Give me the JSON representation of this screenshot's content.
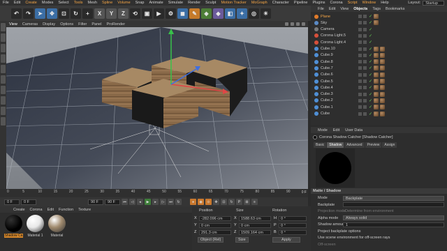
{
  "menu": [
    "File",
    "Edit",
    "Create",
    "Modes",
    "Select",
    "Tools",
    "Mesh",
    "Spline",
    "Volume",
    "Snap",
    "Animate",
    "Simulate",
    "Render",
    "Sculpt",
    "Motion Tracker",
    "MoGraph",
    "Character",
    "Pipeline",
    "Plugins",
    "Corona",
    "Script",
    "Window",
    "Help"
  ],
  "highlighted_menu": [
    "Create",
    "Tools",
    "Spline",
    "Volume",
    "Motion Tracker",
    "MoGraph",
    "Script",
    "Window"
  ],
  "layout": {
    "label": "Layout:",
    "value": "Startup"
  },
  "toolbar": [
    "X",
    "Y",
    "Z"
  ],
  "viewport_menu": {
    "items": [
      "View",
      "Cameras",
      "Display",
      "Options",
      "Filter",
      "Panel",
      "ProRender"
    ],
    "selected": "View"
  },
  "timeline": {
    "ticks": [
      "0",
      "5",
      "10",
      "15",
      "20",
      "25",
      "30",
      "35",
      "40",
      "45",
      "50",
      "55",
      "60",
      "65",
      "70",
      "75",
      "80",
      "85",
      "90"
    ],
    "end_label": "0 F",
    "start_field": "0 F",
    "current_field": "0 F",
    "end_field": "90 F",
    "end_field2": "90 F"
  },
  "material_manager": {
    "menu": [
      "Create",
      "Corona",
      "Edit",
      "Function",
      "Texture"
    ],
    "materials": [
      {
        "label": "Shadow Ca",
        "selected": true,
        "color": "#000000"
      },
      {
        "label": "Material 1",
        "selected": false,
        "color": "#e8e8e8"
      },
      {
        "label": "Material",
        "selected": false,
        "color": "#a08a6e"
      }
    ]
  },
  "coordinates": {
    "headers": [
      "Position",
      "Size",
      "Rotation"
    ],
    "rows": [
      {
        "axis": "X",
        "pos": "-282.096 cm",
        "size_axis": "X",
        "size": "1588.63 cm",
        "rot_axis": "H",
        "rot": "0 °"
      },
      {
        "axis": "Y",
        "pos": "0 cm",
        "size_axis": "Y",
        "size": "0 cm",
        "rot_axis": "P",
        "rot": "0 °"
      },
      {
        "axis": "Z",
        "pos": "291.3 cm",
        "size_axis": "Z",
        "size": "1509.164 cm",
        "rot_axis": "B",
        "rot": "0 °"
      }
    ],
    "mode": "Object (Rel)",
    "size_mode": "Size",
    "apply": "Apply"
  },
  "object_manager": {
    "tabs": [
      "File",
      "Edit",
      "View",
      "Objects",
      "Tags",
      "Bookmarks"
    ],
    "active_tab": "Objects",
    "objects": [
      {
        "name": "Plane",
        "color": "#e07b2a",
        "tags": 1,
        "sel": true
      },
      {
        "name": "Sky",
        "color": "#5a8ac6",
        "tags": 1
      },
      {
        "name": "Camera",
        "color": "#7a7a7a",
        "tags": 0
      },
      {
        "name": "Corona Light.5",
        "color": "#d84f3a",
        "tags": 0
      },
      {
        "name": "Corona Light.4",
        "color": "#d84f3a",
        "tags": 0
      },
      {
        "name": "Cube.10",
        "color": "#4f8fd6",
        "tags": 2
      },
      {
        "name": "Cube.9",
        "color": "#4f8fd6",
        "tags": 2
      },
      {
        "name": "Cube.8",
        "color": "#4f8fd6",
        "tags": 2
      },
      {
        "name": "Cube.7",
        "color": "#4f8fd6",
        "tags": 2
      },
      {
        "name": "Cube.6",
        "color": "#4f8fd6",
        "tags": 2
      },
      {
        "name": "Cube.5",
        "color": "#4f8fd6",
        "tags": 2
      },
      {
        "name": "Cube.4",
        "color": "#4f8fd6",
        "tags": 2
      },
      {
        "name": "Cube.3",
        "color": "#4f8fd6",
        "tags": 2
      },
      {
        "name": "Cube.2",
        "color": "#4f8fd6",
        "tags": 2
      },
      {
        "name": "Cube.1",
        "color": "#4f8fd6",
        "tags": 2
      },
      {
        "name": "Cube",
        "color": "#4f8fd6",
        "tags": 2
      }
    ]
  },
  "attributes": {
    "menu": [
      "Mode",
      "Edit",
      "User Data"
    ],
    "title": "Corona Shadow Catcher [Shadow Catcher]",
    "tabs": [
      "Basic",
      "Shadow",
      "Advanced",
      "Preview",
      "Assign"
    ],
    "active_tab": "Shadow",
    "section": "Matte / Shadow",
    "rows": [
      {
        "label": "Mode",
        "value": "Backplate",
        "kind": "dd"
      },
      {
        "label": "Backplate",
        "value": "",
        "kind": "fld"
      },
      {
        "label": "Projection mode",
        "value": "Determine from environment",
        "kind": "dim"
      },
      {
        "label": "Alpha mode",
        "value": "Always solid",
        "kind": "dd"
      },
      {
        "label": "Shadow amount",
        "value": "1",
        "kind": "fld"
      },
      {
        "label": "Project backplate options",
        "value": "",
        "kind": "none"
      },
      {
        "label": "Use scene environment for off-screen rays",
        "value": "✓",
        "kind": "none"
      },
      {
        "label": "Off-screen",
        "value": "",
        "kind": "dim"
      }
    ]
  }
}
